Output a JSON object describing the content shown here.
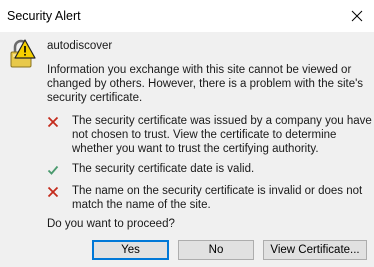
{
  "window": {
    "title": "Security Alert"
  },
  "dialog": {
    "site": "autodiscover",
    "intro": "Information you exchange with this site cannot be viewed or changed by others. However, there is a problem with the site's security certificate.",
    "items": [
      {
        "status": "error",
        "icon": "red-x-icon",
        "text": "The security certificate was issued by a company you have not chosen to trust. View the certificate to determine whether you want to trust the certifying authority."
      },
      {
        "status": "ok",
        "icon": "green-check-icon",
        "text": "The security certificate date is valid."
      },
      {
        "status": "error",
        "icon": "red-x-icon",
        "text": "The name on the security certificate is invalid or does not match the name of the site."
      }
    ],
    "question": "Do you want to proceed?"
  },
  "buttons": {
    "yes": "Yes",
    "no": "No",
    "view": "View Certificate..."
  },
  "colors": {
    "error": "#c42b1c",
    "ok": "#4a9a6e",
    "default_button_border": "#0078d7"
  }
}
